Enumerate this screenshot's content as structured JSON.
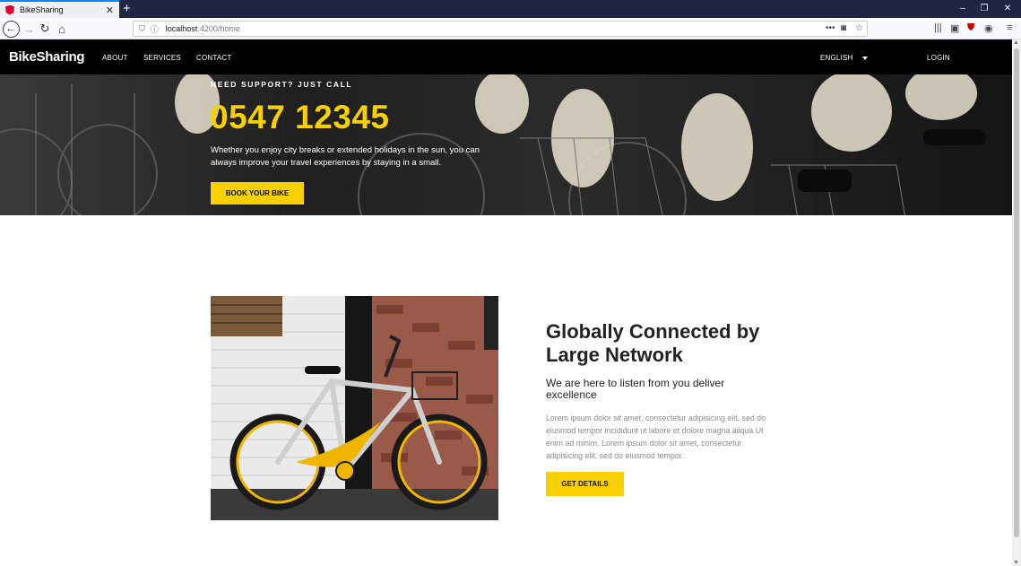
{
  "browser": {
    "tab_title": "BikeSharing",
    "tab_close": "✕",
    "new_tab": "+",
    "url_host": "localhost",
    "url_path": ":4200/home",
    "window_controls": [
      "–",
      "❐",
      "✕"
    ],
    "icons": [
      "back-icon",
      "forward-icon",
      "reload-icon",
      "home-icon",
      "shield-icon",
      "info-icon",
      "more-icon",
      "pocket-icon",
      "star-icon",
      "library-icon",
      "sidebar-icon",
      "ublock-icon",
      "account-icon",
      "menu-icon"
    ]
  },
  "site": {
    "logo": "BikeSharing",
    "nav": [
      "ABOUT",
      "SERVICES",
      "CONTACT"
    ],
    "language": "ENGLISH",
    "login": "LOGIN"
  },
  "hero": {
    "support_label": "NEED SUPPORT? JUST CALL",
    "phone": "0547 12345",
    "description": "Whether you enjoy city breaks or extended holidays in the sun, you can always improve your travel experiences by staying in a small.",
    "button": "BOOK YOUR BIKE"
  },
  "feature": {
    "title": "Globally Connected by Large Network",
    "subtitle": "We are here to listen from you deliver excellence",
    "body": "Lorem ipsum dolor sit amet, consectetur adipisicing elit, sed do eiusmod tempor incididunt ut labore et dolore magna aliqua.Ut enim ad minim. Lorem ipsum dolor sit amet, consectetur adipisicing elit, sed do eiusmod tempor.",
    "button": "GET DETAILS"
  },
  "colors": {
    "accent": "#f7d000",
    "nav_bg": "#000000",
    "tabbar_bg": "#1f2542"
  }
}
